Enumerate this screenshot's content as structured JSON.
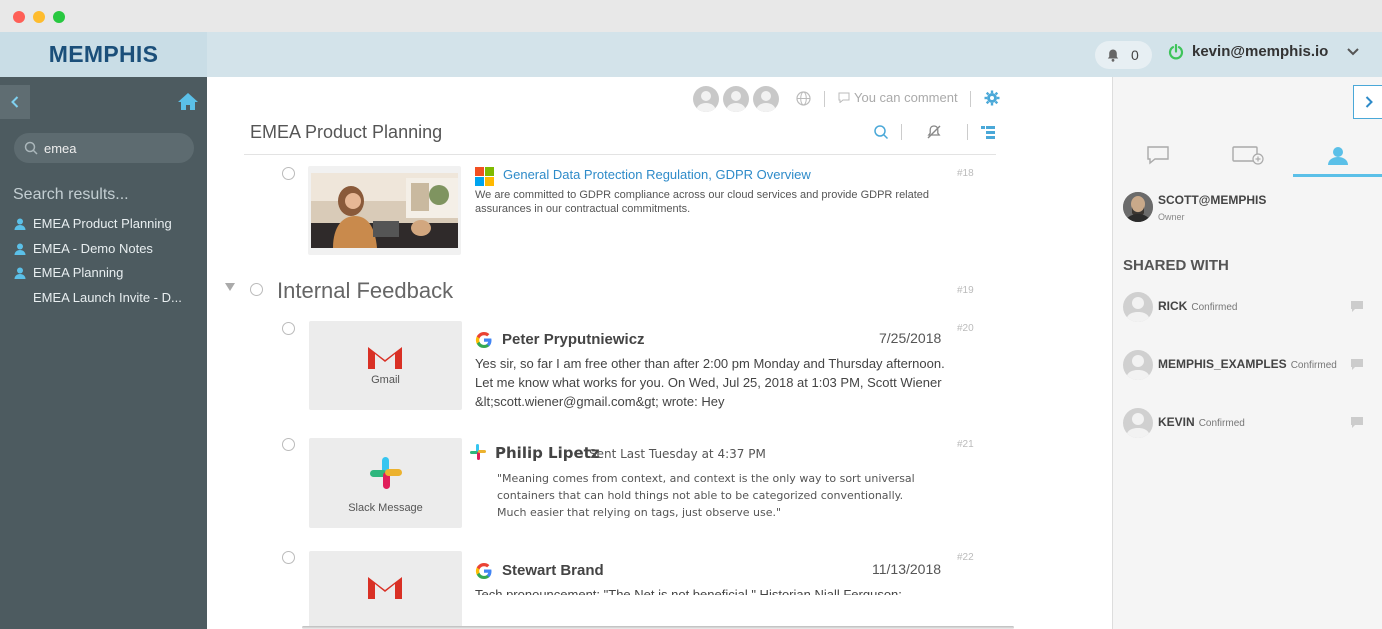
{
  "app": {
    "brand": "MEMPHIS"
  },
  "header": {
    "notification_count": "0",
    "user_email": "kevin@memphis.io"
  },
  "sidebar": {
    "search_value": "emea",
    "results_title": "Search results...",
    "results": [
      {
        "label": "EMEA Product Planning",
        "icon": "users-icon"
      },
      {
        "label": "EMEA - Demo Notes",
        "icon": "users-icon"
      },
      {
        "label": "EMEA Planning",
        "icon": "users-icon"
      },
      {
        "label": "EMEA Launch Invite - D..."
      }
    ]
  },
  "main": {
    "comment_hint": "You can comment",
    "doc_title": "EMEA Product Planning",
    "items": [
      {
        "num": "#18",
        "title": "General Data Protection Regulation, GDPR Overview",
        "desc": "We are committed to GDPR compliance across our cloud services and provide GDPR related assurances in our contractual commitments."
      },
      {
        "num": "#19",
        "section": "Internal Feedback"
      },
      {
        "num": "#20",
        "thumb_label": "Gmail",
        "sender": "Peter Pryputniewicz",
        "date": "7/25/2018",
        "text": "Yes sir, so far I am free other than after 2:00 pm Monday and Thursday afternoon. Let me know what works for you. On Wed, Jul 25, 2018 at 1:03 PM, Scott Wiener &lt;scott.wiener@gmail.com&gt; wrote: Hey"
      },
      {
        "num": "#21",
        "thumb_label": "Slack Message",
        "sender": "Philip Lipetz",
        "sent": "Sent Last Tuesday at 4:37 PM",
        "text": "\"Meaning comes from context, and context is the only way to sort universal containers that can hold things not able to be categorized conventionally.  Much easier that relying on tags, just observe use.\""
      },
      {
        "num": "#22",
        "sender": "Stewart Brand",
        "date": "11/13/2018",
        "text": "Tech pronouncement: \"The Net is not beneficial \" Historian Niall Ferguson:"
      }
    ]
  },
  "right_panel": {
    "owner": {
      "name": "SCOTT@MEMPHIS",
      "role": "Owner"
    },
    "shared_title": "SHARED WITH",
    "shared": [
      {
        "name": "RICK",
        "status": "Confirmed"
      },
      {
        "name": "MEMPHIS_EXAMPLES",
        "status": "Confirmed"
      },
      {
        "name": "KEVIN",
        "status": "Confirmed"
      }
    ]
  }
}
